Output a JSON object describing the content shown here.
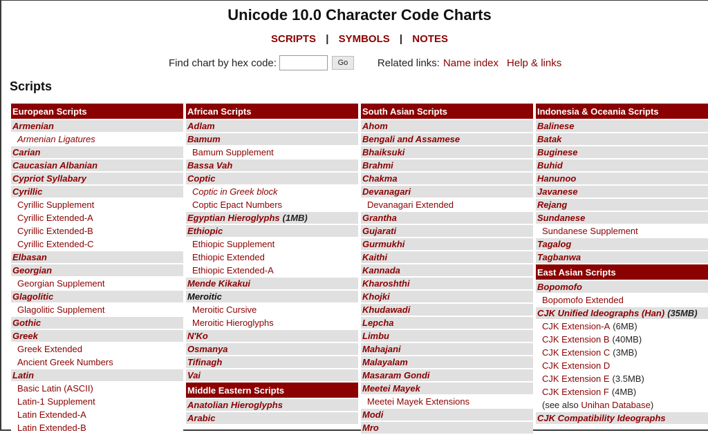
{
  "page": {
    "title": "Unicode 10.0 Character Code Charts",
    "nav": [
      "SCRIPTS",
      "SYMBOLS",
      "NOTES"
    ],
    "nav_separator": "|",
    "find_label": "Find chart by hex code:",
    "find_value": "",
    "go_label": "Go",
    "related_label": "Related links:",
    "related_links": [
      "Name index",
      "Help & links"
    ],
    "section_heading": "Scripts"
  },
  "colors": {
    "accent": "#8b0000",
    "row_bg": "#e0e0e0"
  },
  "columns": [
    {
      "blocks": [
        {
          "header": "European Scripts",
          "items": [
            {
              "label": "Armenian",
              "type": "main"
            },
            {
              "label": "Armenian Ligatures",
              "type": "sub-italic"
            },
            {
              "label": "Carian",
              "type": "main"
            },
            {
              "label": "Caucasian Albanian",
              "type": "main"
            },
            {
              "label": "Cypriot Syllabary",
              "type": "main"
            },
            {
              "label": "Cyrillic",
              "type": "main"
            },
            {
              "label": "Cyrillic Supplement",
              "type": "sub"
            },
            {
              "label": "Cyrillic Extended-A",
              "type": "sub"
            },
            {
              "label": "Cyrillic Extended-B",
              "type": "sub"
            },
            {
              "label": "Cyrillic Extended-C",
              "type": "sub"
            },
            {
              "label": "Elbasan",
              "type": "main"
            },
            {
              "label": "Georgian",
              "type": "main"
            },
            {
              "label": "Georgian Supplement",
              "type": "sub"
            },
            {
              "label": "Glagolitic",
              "type": "main"
            },
            {
              "label": "Glagolitic Supplement",
              "type": "sub"
            },
            {
              "label": "Gothic",
              "type": "main"
            },
            {
              "label": "Greek",
              "type": "main"
            },
            {
              "label": "Greek Extended",
              "type": "sub"
            },
            {
              "label": "Ancient Greek Numbers",
              "type": "sub"
            },
            {
              "label": "Latin",
              "type": "main"
            },
            {
              "label": "Basic Latin (ASCII)",
              "type": "sub"
            },
            {
              "label": "Latin-1 Supplement",
              "type": "sub"
            },
            {
              "label": "Latin Extended-A",
              "type": "sub"
            },
            {
              "label": "Latin Extended-B",
              "type": "sub"
            }
          ]
        }
      ]
    },
    {
      "blocks": [
        {
          "header": "African Scripts",
          "items": [
            {
              "label": "Adlam",
              "type": "main"
            },
            {
              "label": "Bamum",
              "type": "main"
            },
            {
              "label": "Bamum Supplement",
              "type": "sub"
            },
            {
              "label": "Bassa Vah",
              "type": "main"
            },
            {
              "label": "Coptic",
              "type": "main"
            },
            {
              "label": "Coptic in Greek block",
              "type": "sub-italic"
            },
            {
              "label": "Coptic Epact Numbers",
              "type": "sub"
            },
            {
              "label": "Egyptian Hieroglyphs",
              "type": "main",
              "size": "(1MB)"
            },
            {
              "label": "Ethiopic",
              "type": "main"
            },
            {
              "label": "Ethiopic Supplement",
              "type": "sub"
            },
            {
              "label": "Ethiopic Extended",
              "type": "sub"
            },
            {
              "label": "Ethiopic Extended-A",
              "type": "sub"
            },
            {
              "label": "Mende Kikakui",
              "type": "main"
            },
            {
              "label": "Meroitic",
              "type": "main-black"
            },
            {
              "label": "Meroitic Cursive",
              "type": "sub"
            },
            {
              "label": "Meroitic Hieroglyphs",
              "type": "sub"
            },
            {
              "label": "N'Ko",
              "type": "main"
            },
            {
              "label": "Osmanya",
              "type": "main"
            },
            {
              "label": "Tifinagh",
              "type": "main"
            },
            {
              "label": "Vai",
              "type": "main"
            }
          ]
        },
        {
          "header": "Middle Eastern Scripts",
          "items": [
            {
              "label": "Anatolian Hieroglyphs",
              "type": "main"
            },
            {
              "label": "Arabic",
              "type": "main"
            }
          ]
        }
      ]
    },
    {
      "blocks": [
        {
          "header": "South Asian Scripts",
          "items": [
            {
              "label": "Ahom",
              "type": "main"
            },
            {
              "label": "Bengali and Assamese",
              "type": "main"
            },
            {
              "label": "Bhaiksuki",
              "type": "main"
            },
            {
              "label": "Brahmi",
              "type": "main"
            },
            {
              "label": "Chakma",
              "type": "main"
            },
            {
              "label": "Devanagari",
              "type": "main"
            },
            {
              "label": "Devanagari Extended",
              "type": "sub"
            },
            {
              "label": "Grantha",
              "type": "main"
            },
            {
              "label": "Gujarati",
              "type": "main"
            },
            {
              "label": "Gurmukhi",
              "type": "main"
            },
            {
              "label": "Kaithi",
              "type": "main"
            },
            {
              "label": "Kannada",
              "type": "main"
            },
            {
              "label": "Kharoshthi",
              "type": "main"
            },
            {
              "label": "Khojki",
              "type": "main"
            },
            {
              "label": "Khudawadi",
              "type": "main"
            },
            {
              "label": "Lepcha",
              "type": "main"
            },
            {
              "label": "Limbu",
              "type": "main"
            },
            {
              "label": "Mahajani",
              "type": "main"
            },
            {
              "label": "Malayalam",
              "type": "main"
            },
            {
              "label": "Masaram Gondi",
              "type": "main"
            },
            {
              "label": "Meetei Mayek",
              "type": "main"
            },
            {
              "label": "Meetei Mayek Extensions",
              "type": "sub"
            },
            {
              "label": "Modi",
              "type": "main"
            },
            {
              "label": "Mro",
              "type": "main"
            }
          ]
        }
      ]
    },
    {
      "blocks": [
        {
          "header": "Indonesia & Oceania Scripts",
          "items": [
            {
              "label": "Balinese",
              "type": "main"
            },
            {
              "label": "Batak",
              "type": "main"
            },
            {
              "label": "Buginese",
              "type": "main"
            },
            {
              "label": "Buhid",
              "type": "main"
            },
            {
              "label": "Hanunoo",
              "type": "main"
            },
            {
              "label": "Javanese",
              "type": "main"
            },
            {
              "label": "Rejang",
              "type": "main"
            },
            {
              "label": "Sundanese",
              "type": "main"
            },
            {
              "label": "Sundanese Supplement",
              "type": "sub"
            },
            {
              "label": "Tagalog",
              "type": "main"
            },
            {
              "label": "Tagbanwa",
              "type": "main"
            }
          ]
        },
        {
          "header": "East Asian Scripts",
          "items": [
            {
              "label": "Bopomofo",
              "type": "main"
            },
            {
              "label": "Bopomofo Extended",
              "type": "sub"
            },
            {
              "label": "CJK Unified Ideographs (Han)",
              "type": "main",
              "size": "(35MB)"
            },
            {
              "label": "CJK Extension-A",
              "type": "sub",
              "size": "(6MB)"
            },
            {
              "label": "CJK Extension B",
              "type": "sub",
              "size": "(40MB)"
            },
            {
              "label": "CJK Extension C",
              "type": "sub",
              "size": "(3MB)"
            },
            {
              "label": "CJK Extension D",
              "type": "sub"
            },
            {
              "label": "CJK Extension E",
              "type": "sub",
              "size": "(3.5MB)"
            },
            {
              "label": "CJK Extension F",
              "type": "sub",
              "size": "(4MB)"
            },
            {
              "label": "Unihan Database",
              "type": "see-also",
              "prefix": "(see also ",
              "suffix": ")"
            },
            {
              "label": "CJK Compatibility Ideographs",
              "type": "main"
            }
          ]
        }
      ]
    }
  ]
}
